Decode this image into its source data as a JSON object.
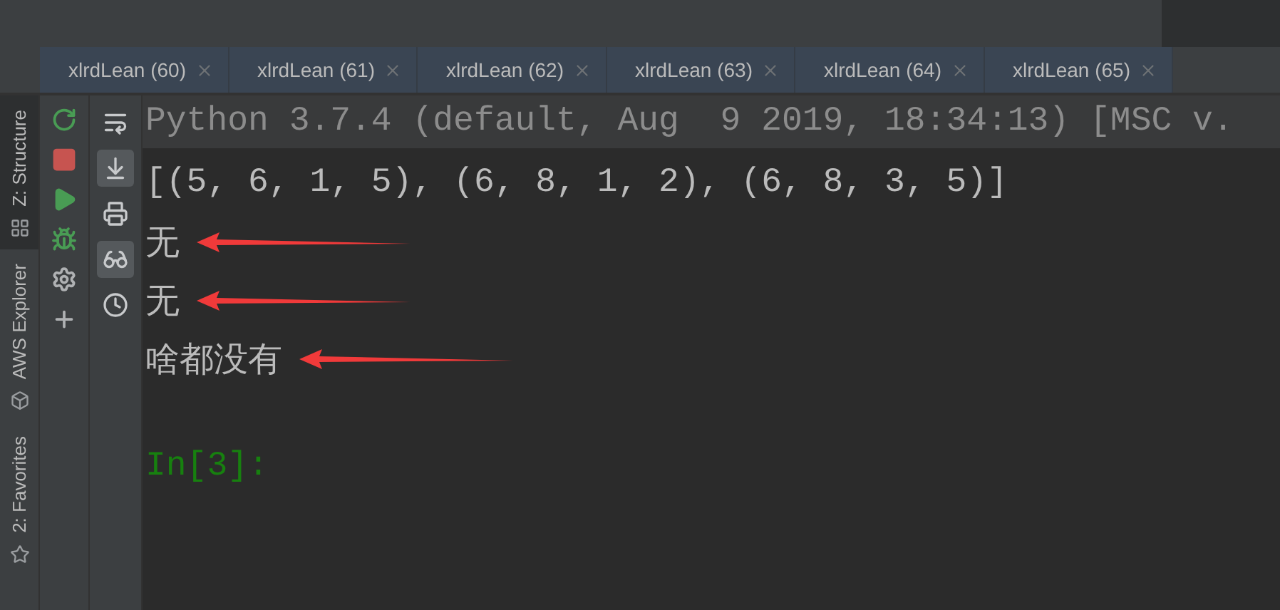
{
  "side_tabs": [
    {
      "label": "Z: Structure",
      "kind": "structure",
      "selected": true
    },
    {
      "label": "AWS Explorer",
      "kind": "cube",
      "selected": false
    },
    {
      "label": "2: Favorites",
      "kind": "star",
      "selected": false
    }
  ],
  "editor_tabs": [
    {
      "label": "xlrdLean (60)"
    },
    {
      "label": "xlrdLean (61)"
    },
    {
      "label": "xlrdLean (62)"
    },
    {
      "label": "xlrdLean (63)"
    },
    {
      "label": "xlrdLean (64)"
    },
    {
      "label": "xlrdLean (65)"
    }
  ],
  "run_toolbar": [
    {
      "kind": "rerun"
    },
    {
      "kind": "stop"
    },
    {
      "kind": "run"
    },
    {
      "kind": "debug"
    },
    {
      "kind": "settings"
    },
    {
      "kind": "add"
    }
  ],
  "console_toolbar": [
    {
      "kind": "wrap",
      "on": false
    },
    {
      "kind": "scroll_end",
      "on": true
    },
    {
      "kind": "print",
      "on": false
    },
    {
      "kind": "glasses",
      "on": true
    },
    {
      "kind": "history",
      "on": false
    }
  ],
  "console": {
    "header": "Python 3.7.4 (default, Aug  9 2019, 18:34:13) [MSC v.",
    "lines": [
      {
        "text": "[(5, 6, 1, 5), (6, 8, 1, 2), (6, 8, 3, 5)]",
        "arrow": false
      },
      {
        "text": "无",
        "arrow": true
      },
      {
        "text": "无",
        "arrow": true
      },
      {
        "text": "啥都没有",
        "arrow": true
      }
    ],
    "prompt": "In[3]:"
  }
}
